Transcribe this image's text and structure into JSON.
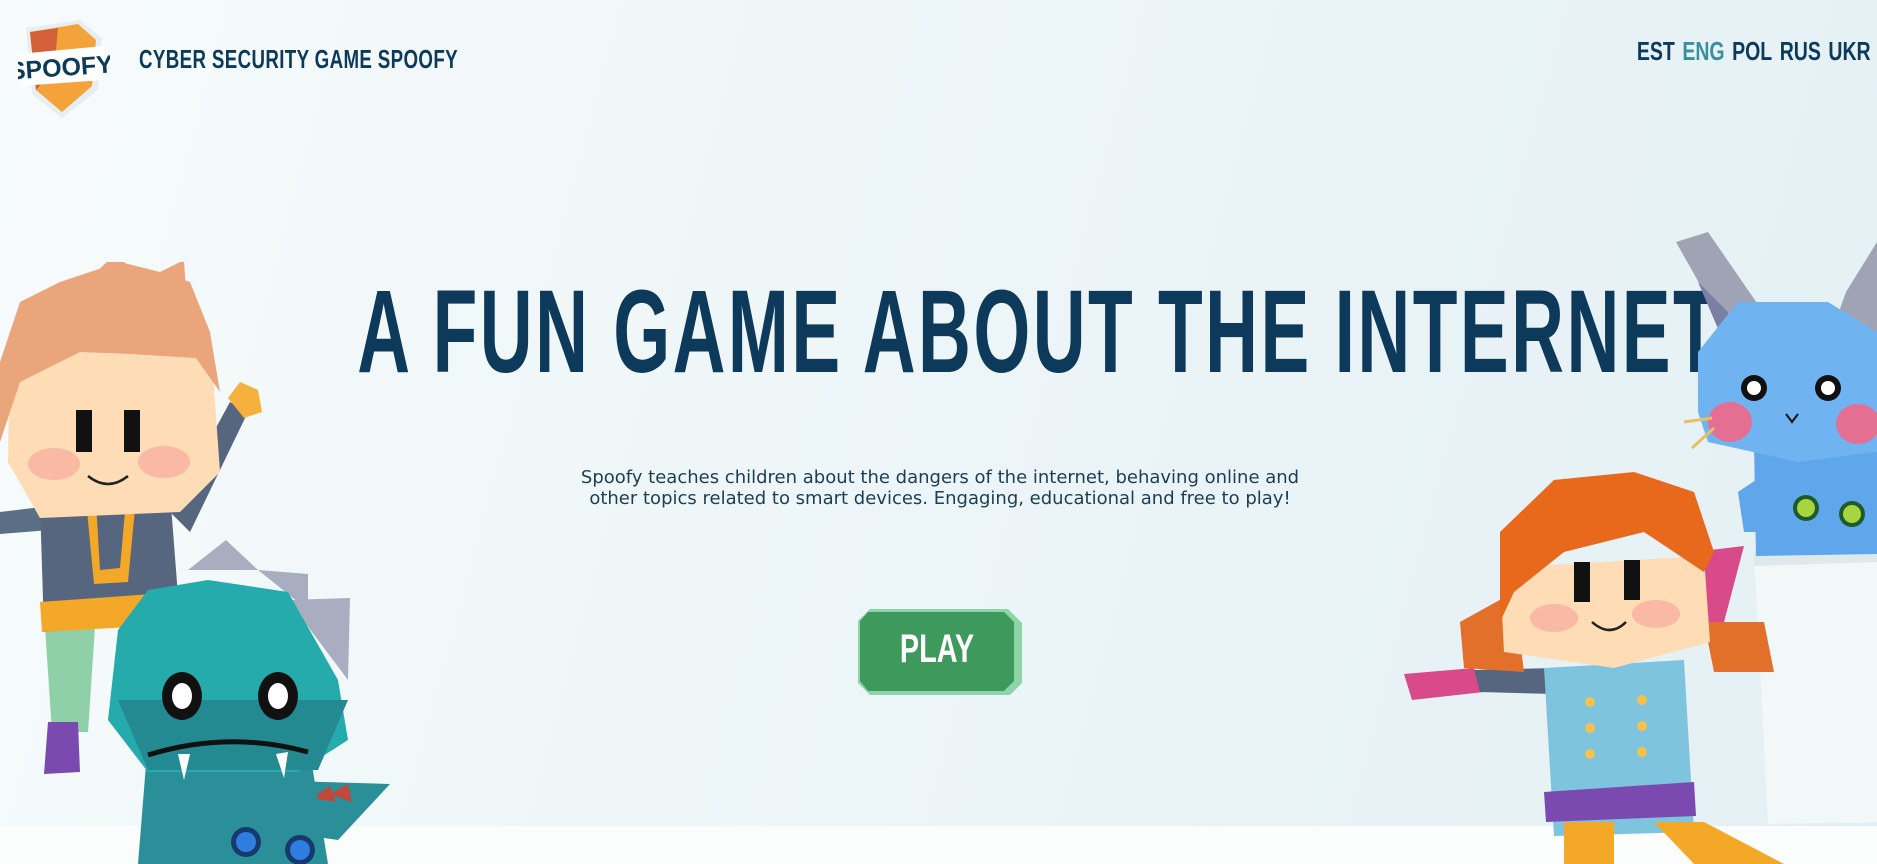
{
  "header": {
    "logo_text": "SPOOFY",
    "site_title": "CYBER SECURITY GAME SPOOFY",
    "languages": [
      {
        "code": "EST",
        "active": false
      },
      {
        "code": "ENG",
        "active": true
      },
      {
        "code": "POL",
        "active": false
      },
      {
        "code": "RUS",
        "active": false
      },
      {
        "code": "UKR",
        "active": false
      }
    ]
  },
  "hero": {
    "title": "A FUN GAME ABOUT THE INTERNET!",
    "description": "Spoofy teaches children about the dangers of the internet, behaving online and other topics related to smart devices. Engaging, educational and free to play!",
    "play_label": "PLAY"
  },
  "colors": {
    "navy": "#0d3a5a",
    "accent_teal": "#3a8f9c",
    "play_green": "#3e9a5c",
    "play_border": "#8fd3a8"
  },
  "characters": [
    "boy-character",
    "dinosaur-character",
    "girl-character",
    "bunny-character"
  ]
}
